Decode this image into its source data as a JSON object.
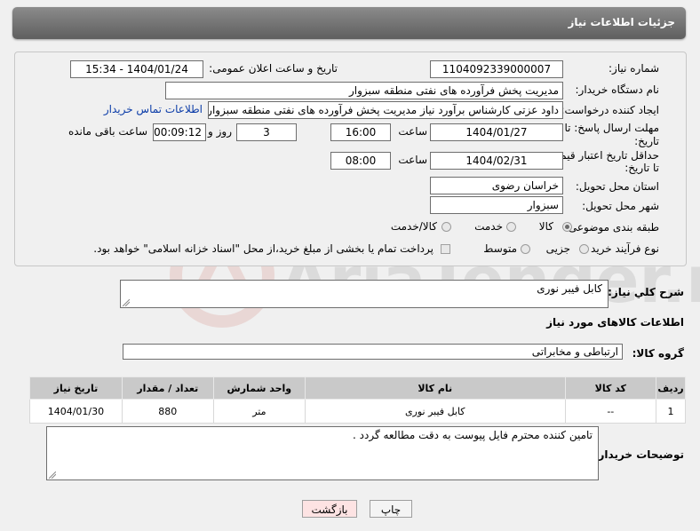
{
  "header": {
    "title": "جزئیات اطلاعات نیاز"
  },
  "form": {
    "need_number_label": "شماره نیاز:",
    "need_number": "1104092339000007",
    "announce_label": "تاریخ و ساعت اعلان عمومی:",
    "announce_value": "1404/01/24 - 15:34",
    "buyer_label": "نام دستگاه خریدار:",
    "buyer_value": "مدیریت پخش فرآورده های نفتی منطقه سبزوار",
    "creator_label": "ایجاد کننده درخواست:",
    "creator_value": "داود عزتی کارشناس برآورد نیاز مدیریت پخش فرآورده های نفتی منطقه سبزوار",
    "contact_link": "اطلاعات تماس خریدار",
    "deadline_label_1": "مهلت ارسال پاسخ: تا",
    "deadline_label_2": "تاریخ:",
    "deadline_date": "1404/01/27",
    "hour_label": "ساعت",
    "deadline_time": "16:00",
    "days_value": "3",
    "days_label": "روز و",
    "remaining_value": "00:09:12",
    "remaining_label": "ساعت باقی مانده",
    "validity_label_1": "حداقل تاریخ اعتبار قیمت:",
    "validity_label_2": "تا تاریخ:",
    "validity_date": "1404/02/31",
    "validity_time": "08:00",
    "province_label": "استان محل تحویل:",
    "province_value": "خراسان رضوی",
    "city_label": "شهر محل تحویل:",
    "city_value": "سبزوار",
    "category_label": "طبقه بندی موضوعی:",
    "category_options": [
      "کالا",
      "خدمت",
      "کالا/خدمت"
    ],
    "category_selected": "کالا",
    "process_label": "نوع فرآیند خرید :",
    "process_options": [
      "جزیی",
      "متوسط"
    ],
    "payment_note": "پرداخت تمام یا بخشی از مبلغ خرید،از محل \"اسناد خزانه اسلامی\" خواهد بود."
  },
  "description": {
    "label": "شرح کلي نياز:",
    "value": "کابل فیبر نوری"
  },
  "goods_section_title": "اطلاعات کالاهای مورد نیاز",
  "goods_group": {
    "label": "گروه کالا:",
    "value": "ارتباطی و مخابراتی"
  },
  "table": {
    "headers": [
      "ردیف",
      "کد کالا",
      "نام کالا",
      "واحد شمارش",
      "تعداد / مقدار",
      "تاریخ نیاز"
    ],
    "rows": [
      [
        "1",
        "--",
        "کابل فیبر نوری",
        "متر",
        "880",
        "1404/01/30"
      ]
    ]
  },
  "buyer_notes": {
    "label": "توضیحات خریدار:",
    "value": "تامین کننده محترم فایل پیوست به دقت مطالعه گردد ."
  },
  "buttons": {
    "print": "چاپ",
    "back": "بازگشت"
  },
  "watermark": {
    "text": "AriaTender.neT"
  }
}
